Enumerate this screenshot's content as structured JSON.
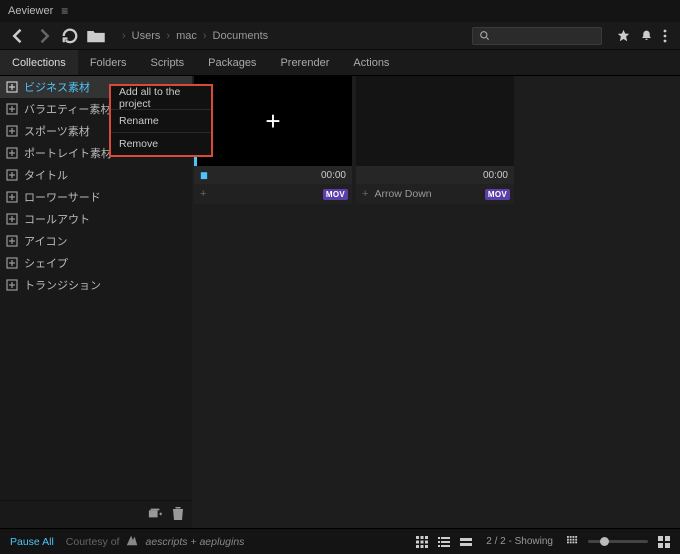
{
  "app": {
    "title": "Aeviewer"
  },
  "breadcrumbs": [
    "Users",
    "mac",
    "Documents"
  ],
  "tabs": [
    {
      "label": "Collections",
      "active": true
    },
    {
      "label": "Folders"
    },
    {
      "label": "Scripts"
    },
    {
      "label": "Packages"
    },
    {
      "label": "Prerender"
    },
    {
      "label": "Actions"
    }
  ],
  "sidebar": {
    "items": [
      {
        "label": "ビジネス素材",
        "active": true
      },
      {
        "label": "バラエティー素材"
      },
      {
        "label": "スポーツ素材"
      },
      {
        "label": "ポートレイト素材"
      },
      {
        "label": "タイトル"
      },
      {
        "label": "ローワーサード"
      },
      {
        "label": "コールアウト"
      },
      {
        "label": "アイコン"
      },
      {
        "label": "シェイプ"
      },
      {
        "label": "トランジション"
      }
    ]
  },
  "context_menu": {
    "items": [
      {
        "label": "Add all to the project"
      },
      {
        "label": "Rename"
      },
      {
        "label": "Remove"
      }
    ]
  },
  "thumbnails": [
    {
      "name": "",
      "time": "00:00",
      "badge": "MOV",
      "has_plus": true,
      "playing": true
    },
    {
      "name": "Arrow Down",
      "time": "00:00",
      "badge": "MOV",
      "has_plus": false,
      "playing": false
    }
  ],
  "status": {
    "pause_all": "Pause All",
    "courtesy": "Courtesy of",
    "brand": "aescripts + aeplugins",
    "count_label": "2 / 2 - Showing"
  }
}
